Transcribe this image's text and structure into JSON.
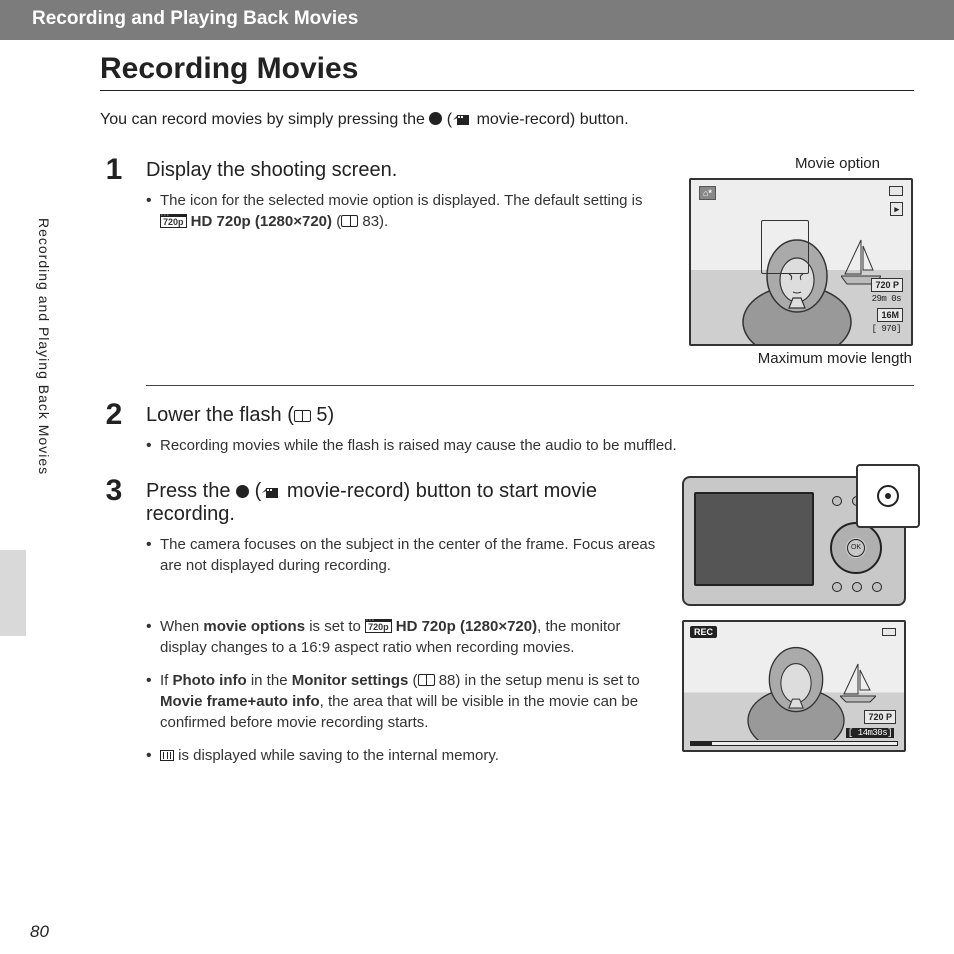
{
  "header": "Recording and Playing Back Movies",
  "title": "Recording Movies",
  "side_label": "Recording and Playing Back Movies",
  "page_number": "80",
  "intro": {
    "before": "You can record movies by simply pressing the ",
    "after": " movie-record) button."
  },
  "resolution_badge": "720p",
  "steps": {
    "s1": {
      "n": "1",
      "heading": "Display the shooting screen.",
      "bullet_a_before": "The icon for the selected movie option is displayed. The default setting is ",
      "bullet_a_mid": " HD 720p (1280×720)",
      "bullet_a_ref": " 83).",
      "caption_top": "Movie option",
      "caption_bottom": "Maximum movie length",
      "lcd_720": "720 P",
      "lcd_time": "29m 0s",
      "lcd_16m": "16M",
      "lcd_count": "[  970]"
    },
    "s2": {
      "n": "2",
      "heading_before": "Lower the flash (",
      "heading_after": " 5)",
      "bullet_a": "Recording movies while the flash is raised may cause the audio to be muffled."
    },
    "s3": {
      "n": "3",
      "heading_before": "Press the ",
      "heading_after": " movie-record) button to start movie recording.",
      "bullet_a": "The camera focuses on the subject in the center of the frame. Focus areas are not displayed during recording.",
      "bullet_b_before": "When ",
      "bullet_b_strong1": "movie options",
      "bullet_b_mid": " is set to ",
      "bullet_b_strong2": " HD 720p (1280×720)",
      "bullet_b_after": ", the monitor display changes to a 16:9 aspect ratio when recording movies.",
      "bullet_c_1": "If ",
      "bullet_c_s1": "Photo info",
      "bullet_c_2": " in the ",
      "bullet_c_s2": "Monitor settings",
      "bullet_c_3_ref": " 88) in the setup menu is set to ",
      "bullet_c_s3": "Movie frame+auto info",
      "bullet_c_4": ", the area that will be visible in the movie can be confirmed before movie recording starts.",
      "bullet_d": " is displayed while saving to the internal memory.",
      "ok": "OK",
      "rec": "REC",
      "rec_720": "720 P",
      "rec_time": "[ 14m30s]"
    }
  }
}
